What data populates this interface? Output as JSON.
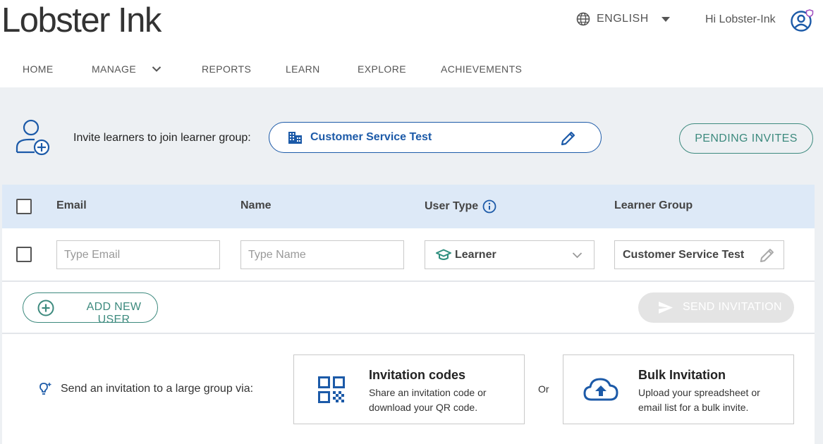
{
  "header": {
    "logo_text": "Lobster Ink",
    "language": "ENGLISH",
    "greeting": "Hi Lobster-Ink"
  },
  "nav": {
    "items": [
      "HOME",
      "MANAGE",
      "REPORTS",
      "LEARN",
      "EXPLORE",
      "ACHIEVEMENTS"
    ]
  },
  "invite": {
    "label": "Invite learners to join learner group:",
    "group_name": "Customer Service Test",
    "pending_label": "PENDING INVITES"
  },
  "table": {
    "columns": [
      "Email",
      "Name",
      "User Type",
      "Learner Group"
    ],
    "row": {
      "email_placeholder": "Type Email",
      "name_placeholder": "Type Name",
      "user_type": "Learner",
      "learner_group": "Customer Service Test"
    }
  },
  "actions": {
    "add_user_label": "ADD NEW USER",
    "send_label": "SEND INVITATION"
  },
  "bulk": {
    "label": "Send an invitation to a large group via:",
    "or_label": "Or",
    "cards": [
      {
        "title": "Invitation codes",
        "description": "Share an invitation code or download your QR code.",
        "icon": "qr-code-icon"
      },
      {
        "title": "Bulk Invitation",
        "description": "Upload your spreadsheet or email list for a bulk invite.",
        "icon": "cloud-upload-icon"
      }
    ]
  },
  "colors": {
    "brand_blue": "#1c5aa8",
    "teal": "#3d8a7e",
    "header_row": "#dde9f7",
    "panel_bg": "#edf0f3",
    "avatar_badge": "#a04ec0"
  }
}
